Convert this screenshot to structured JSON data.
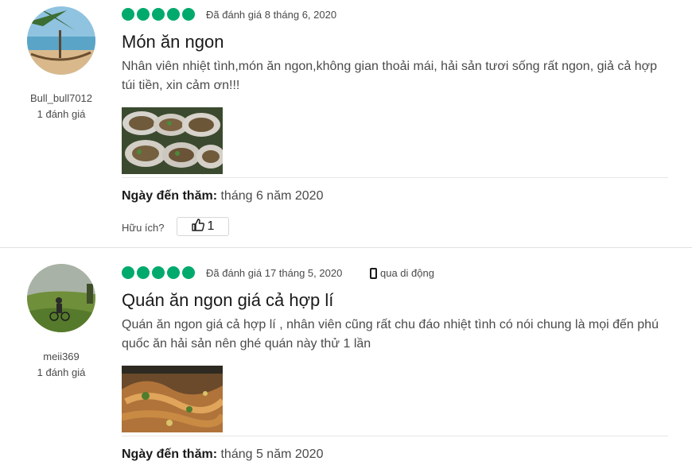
{
  "reviews": [
    {
      "username": "Bull_bull7012",
      "contributions": "1 đánh giá",
      "rating": 5,
      "date": "Đã đánh giá 8 tháng 6, 2020",
      "title": "Món ăn ngon",
      "body": "Nhân viên nhiệt tình,món ăn ngon,không gian thoải mái, hải sản tươi sống rất ngon, giả cả hợp túi tiền, xin cảm ơn!!!",
      "visit_label": "Ngày đến thăm:",
      "visit_value": "tháng 6 năm 2020",
      "helpful_label": "Hữu ích?",
      "helpful_count": "1"
    },
    {
      "username": "meii369",
      "contributions": "1 đánh giá",
      "rating": 5,
      "date": "Đã đánh giá 17 tháng 5, 2020",
      "device": "qua di động",
      "title": "Quán ăn ngon giá cả hợp lí",
      "body": "Quán ăn ngon giá cả hợp lí , nhân viên cũng rất chu đáo nhiệt tình có nói chung là mọi đến phú quốc ăn hải sản nên ghé quán này thử 1 lần",
      "visit_label": "Ngày đến thăm:",
      "visit_value": "tháng 5 năm 2020"
    }
  ],
  "colors": {
    "rating": "#00aa6c",
    "text": "#4a4a4a",
    "title": "#1a1a1a"
  }
}
